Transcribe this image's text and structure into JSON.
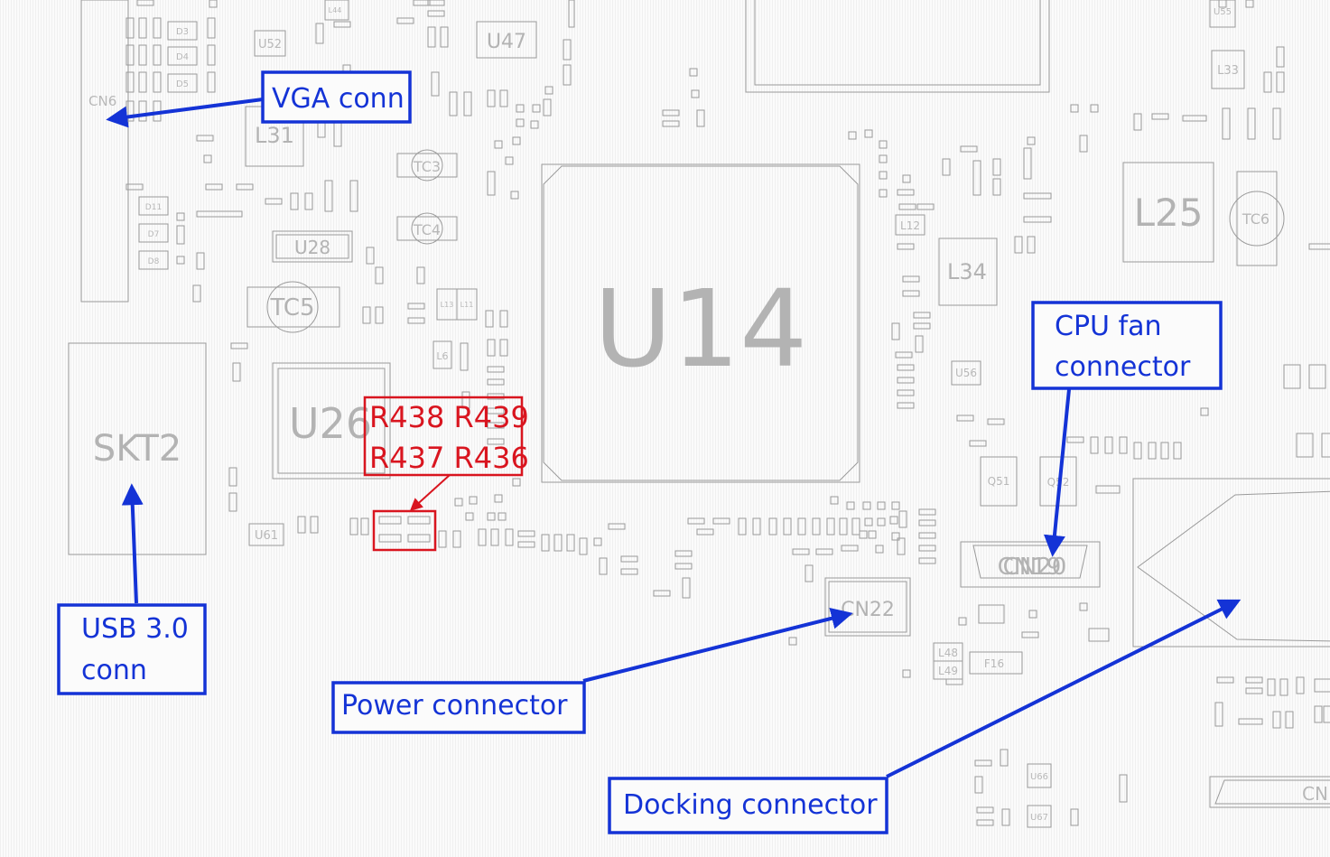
{
  "colors": {
    "annotation_blue": "#1433d6",
    "annotation_red": "#d9151f",
    "component_outline": "#9a9a9a",
    "component_label": "#b3b3b3",
    "board_background": "#fbfbfb"
  },
  "components": {
    "U14": "U14",
    "SKT2": "SKT2",
    "U26": "U26",
    "L25": "L25",
    "L34": "L34",
    "L31": "L31",
    "U47": "U47",
    "U28": "U28",
    "TC5": "TC5",
    "TC6": "TC6",
    "TC3": "TC3",
    "TC4": "TC4",
    "CN22": "CN22",
    "CN19": "CN19",
    "CN20": "CN20",
    "CN6": "CN6",
    "CN_partial": "CN",
    "U52": "U52",
    "U56": "U56",
    "U61": "U61",
    "U55": "U55",
    "U66": "U66",
    "U67": "U67",
    "L33": "L33",
    "L12": "L12",
    "L6": "L6",
    "L48": "L48",
    "L49": "L49",
    "F16": "F16",
    "Q51": "Q51",
    "Q52": "Q52",
    "L44": "L44",
    "L11": "L11",
    "L13": "L13",
    "D3": "D3",
    "D4": "D4",
    "D5": "D5",
    "D11": "D11",
    "D7": "D7",
    "D8": "D8"
  },
  "annotations": {
    "vga": "VGA conn",
    "usb_line1": "USB 3.0",
    "usb_line2": "conn",
    "cpu_fan_line1": "CPU fan",
    "cpu_fan_line2": "connector",
    "power": "Power connector",
    "docking": "Docking connector"
  },
  "resistors": {
    "line1": "R438 R439",
    "line2": "R437 R436"
  }
}
